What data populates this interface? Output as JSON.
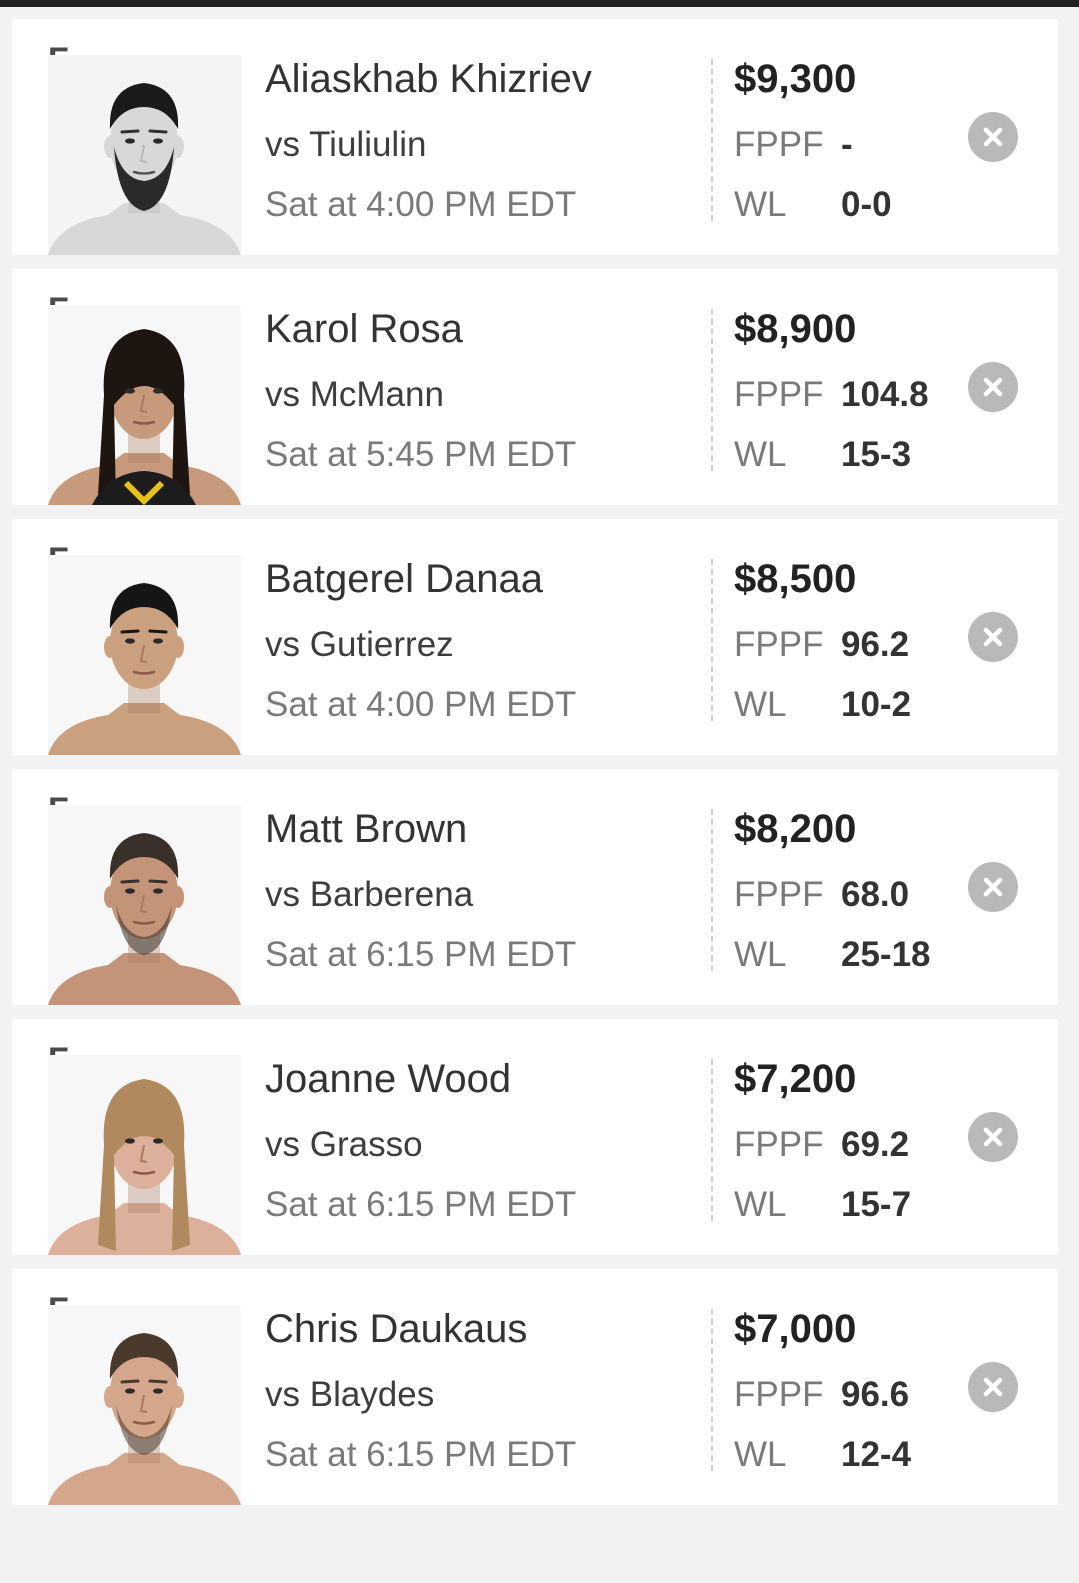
{
  "colors": {
    "background": "#f2f2f2",
    "card": "#ffffff",
    "top_bar": "#222222",
    "remove_button": "#b9b9b9"
  },
  "roster": [
    {
      "position": "F",
      "name": "Aliaskhab Khizriev",
      "opponent": "vs Tiuliulin",
      "time": "Sat at 4:00 PM EDT",
      "salary": "$9,300",
      "fppf_label": "FPPF",
      "fppf": "-",
      "wl_label": "WL",
      "wl": "0-0",
      "photo": {
        "style": "grayscale",
        "hair": "#1a1a1a",
        "beard": "full",
        "skin": "#d8d8d8"
      }
    },
    {
      "position": "F",
      "name": "Karol Rosa",
      "opponent": "vs McMann",
      "time": "Sat at 5:45 PM EDT",
      "salary": "$8,900",
      "fppf_label": "FPPF",
      "fppf": "104.8",
      "wl_label": "WL",
      "wl": "15-3",
      "photo": {
        "style": "color",
        "hair": "#1e1510",
        "beard": "none",
        "skin": "#c89a7c"
      }
    },
    {
      "position": "F",
      "name": "Batgerel Danaa",
      "opponent": "vs Gutierrez",
      "time": "Sat at 4:00 PM EDT",
      "salary": "$8,500",
      "fppf_label": "FPPF",
      "fppf": "96.2",
      "wl_label": "WL",
      "wl": "10-2",
      "photo": {
        "style": "color",
        "hair": "#151515",
        "beard": "none",
        "skin": "#caa07e"
      }
    },
    {
      "position": "F",
      "name": "Matt Brown",
      "opponent": "vs Barberena",
      "time": "Sat at 6:15 PM EDT",
      "salary": "$8,200",
      "fppf_label": "FPPF",
      "fppf": "68.0",
      "wl_label": "WL",
      "wl": "25-18",
      "photo": {
        "style": "color",
        "hair": "#3a302a",
        "beard": "stubble",
        "skin": "#c49478"
      }
    },
    {
      "position": "F",
      "name": "Joanne Wood",
      "opponent": "vs Grasso",
      "time": "Sat at 6:15 PM EDT",
      "salary": "$7,200",
      "fppf_label": "FPPF",
      "fppf": "69.2",
      "wl_label": "WL",
      "wl": "15-7",
      "photo": {
        "style": "color",
        "hair": "#b08a5e",
        "beard": "none",
        "skin": "#dcb09a"
      }
    },
    {
      "position": "F",
      "name": "Chris Daukaus",
      "opponent": "vs Blaydes",
      "time": "Sat at 6:15 PM EDT",
      "salary": "$7,000",
      "fppf_label": "FPPF",
      "fppf": "96.6",
      "wl_label": "WL",
      "wl": "12-4",
      "photo": {
        "style": "color",
        "hair": "#4a3a2e",
        "beard": "stubble",
        "skin": "#d4a68c"
      }
    }
  ]
}
